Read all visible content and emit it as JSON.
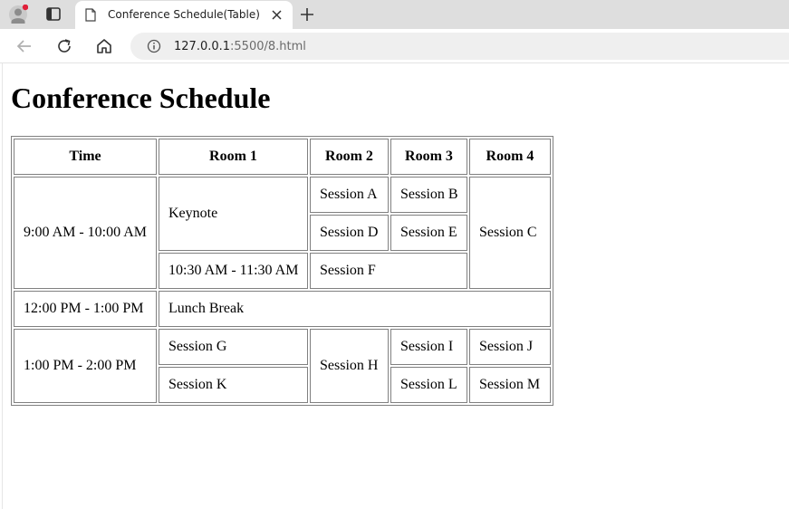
{
  "browser": {
    "tab_title": "Conference Schedule(Table)",
    "url_host": "127.0.0.1",
    "url_rest": ":5500/8.html"
  },
  "page": {
    "title": "Conference Schedule",
    "headers": [
      "Time",
      "Room 1",
      "Room 2",
      "Room 3",
      "Room 4"
    ],
    "cells": {
      "t1": "9:00 AM - 10:00 AM",
      "keynote": "Keynote",
      "session_a": "Session A",
      "session_b": "Session B",
      "session_c": "Session C",
      "session_d": "Session D",
      "session_e": "Session E",
      "t1030": "10:30 AM - 11:30 AM",
      "session_f": "Session F",
      "t12": "12:00 PM - 1:00 PM",
      "lunch": "Lunch Break",
      "t1pm": "1:00 PM - 2:00 PM",
      "session_g": "Session G",
      "session_h": "Session H",
      "session_i": "Session I",
      "session_j": "Session J",
      "session_k": "Session K",
      "session_l": "Session L",
      "session_m": "Session M"
    }
  }
}
